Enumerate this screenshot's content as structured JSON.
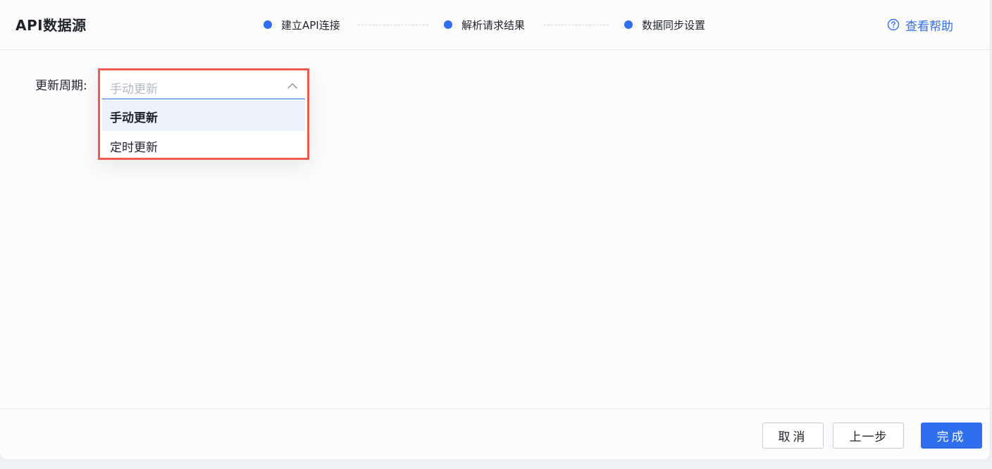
{
  "header": {
    "title": "API数据源",
    "steps": [
      {
        "label": "建立API连接"
      },
      {
        "label": "解析请求结果"
      },
      {
        "label": "数据同步设置"
      }
    ],
    "help_label": "查看帮助"
  },
  "form": {
    "update_cycle_label": "更新周期:",
    "select_value": "手动更新",
    "options": [
      {
        "label": "手动更新",
        "selected": true
      },
      {
        "label": "定时更新",
        "selected": false
      }
    ]
  },
  "footer": {
    "cancel_label": "取消",
    "prev_label": "上一步",
    "finish_label": "完成"
  },
  "colors": {
    "accent": "#2f6fef",
    "highlight_border": "#f05a4f",
    "selected_option_bg": "#edf3fd"
  }
}
